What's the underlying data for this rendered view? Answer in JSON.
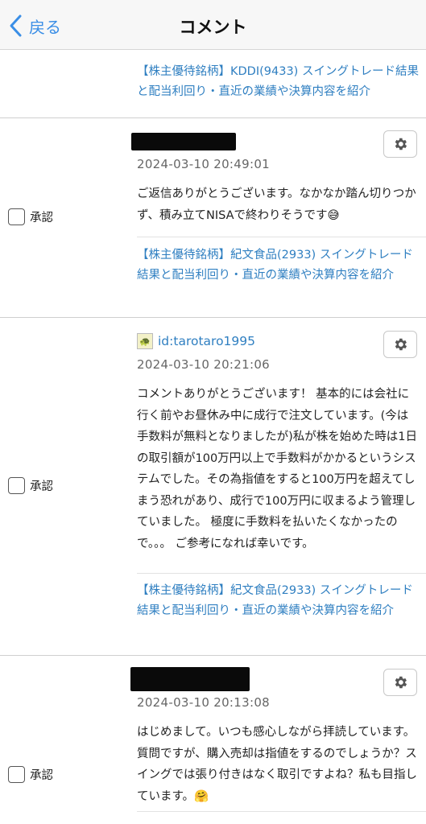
{
  "nav": {
    "back_label": "戻る",
    "title": "コメント"
  },
  "top_link": "【株主優待銘柄】KDDI(9433) スイングトレード結果と配当利回り・直近の業績や決算内容を紹介",
  "comments": [
    {
      "author": "",
      "date": "2024-03-10 20:49:01",
      "body": "ご返信ありがとうございます。なかなか踏ん切りつかず、積み立てNISAで終わりそうです😅",
      "approve_label": "承認",
      "link": "【株主優待銘柄】紀文食品(2933) スイングトレード結果と配当利回り・直近の業績や決算内容を紹介"
    },
    {
      "author": "id:tarotaro1995",
      "date": "2024-03-10 20:21:06",
      "body": "コメントありがとうございます！ 基本的には会社に行く前やお昼休み中に成行で注文しています。(今は手数料が無料となりましたが)私が株を始めた時は1日の取引額が100万円以上で手数料がかかるというシステムでした。その為指値をすると100万円を超えてしまう恐れがあり、成行で100万円に収まるよう管理していました。 極度に手数料を払いたくなかったので。。。 ご参考になれば幸いです。",
      "approve_label": "承認",
      "link": "【株主優待銘柄】紀文食品(2933) スイングトレード結果と配当利回り・直近の業績や決算内容を紹介"
    },
    {
      "author": "",
      "date": "2024-03-10 20:13:08",
      "body": "はじめまして。いつも感心しながら拝読しています。質問ですが、購入売却は指値をするのでしょうか？スイングでは張り付きはなく取引ですよね？私も目指しています。🤗",
      "approve_label": "承認"
    }
  ],
  "colors": {
    "link": "#2f7fc1",
    "nav_back": "#3a8ee6",
    "text": "#222222",
    "date": "#666666"
  }
}
